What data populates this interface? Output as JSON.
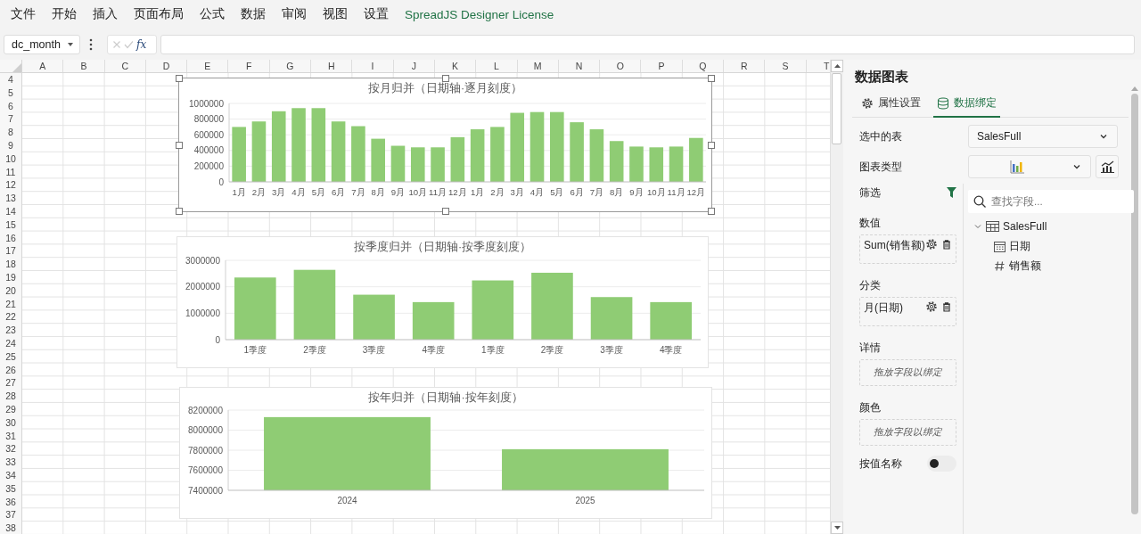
{
  "menu": [
    {
      "label": "文件",
      "kind": "menu"
    },
    {
      "label": "开始",
      "kind": "menu"
    },
    {
      "label": "插入",
      "kind": "menu"
    },
    {
      "label": "页面布局",
      "kind": "menu"
    },
    {
      "label": "公式",
      "kind": "menu"
    },
    {
      "label": "数据",
      "kind": "menu"
    },
    {
      "label": "审阅",
      "kind": "menu"
    },
    {
      "label": "视图",
      "kind": "menu"
    },
    {
      "label": "设置",
      "kind": "menu"
    },
    {
      "label": "SpreadJS Designer License",
      "kind": "link"
    }
  ],
  "formula_bar": {
    "name_box": "dc_month",
    "function_label": "fx"
  },
  "sheet": {
    "columns": [
      "A",
      "B",
      "C",
      "D",
      "E",
      "F",
      "G",
      "H",
      "I",
      "J",
      "K",
      "L",
      "M",
      "N",
      "O",
      "P",
      "Q",
      "R",
      "S",
      "T"
    ],
    "rows": [
      "4",
      "5",
      "6",
      "7",
      "8",
      "9",
      "10",
      "11",
      "12",
      "13",
      "14",
      "15",
      "16",
      "17",
      "18",
      "19",
      "20",
      "21",
      "22",
      "23",
      "24",
      "25",
      "26",
      "27",
      "28",
      "29",
      "30",
      "31",
      "32",
      "33",
      "34",
      "35",
      "36",
      "37",
      "38"
    ]
  },
  "charts": [
    {
      "selected": true,
      "chart_data": {
        "type": "bar",
        "title": "按月归并（日期轴·逐月刻度）",
        "categories": [
          "1月",
          "2月",
          "3月",
          "4月",
          "5月",
          "6月",
          "7月",
          "8月",
          "9月",
          "10月",
          "11月",
          "12月",
          "1月",
          "2月",
          "3月",
          "4月",
          "5月",
          "6月",
          "7月",
          "8月",
          "9月",
          "10月",
          "11月",
          "12月"
        ],
        "series": [
          {
            "color": "#8fcc74",
            "values": [
              700000,
              770000,
              900000,
              940000,
              940000,
              770000,
              710000,
              550000,
              460000,
              440000,
              440000,
              570000,
              670000,
              700000,
              880000,
              890000,
              890000,
              760000,
              670000,
              520000,
              450000,
              440000,
              450000,
              560000
            ]
          }
        ],
        "ylim": [
          0,
          1000000
        ],
        "yticks": [
          0,
          200000,
          400000,
          600000,
          800000,
          1000000
        ],
        "grid": true
      }
    },
    {
      "selected": false,
      "chart_data": {
        "type": "bar",
        "title": "按季度归并（日期轴·按季度刻度）",
        "categories": [
          "1季度",
          "2季度",
          "3季度",
          "4季度",
          "1季度",
          "2季度",
          "3季度",
          "4季度"
        ],
        "series": [
          {
            "color": "#8fcc74",
            "values": [
              2350000,
              2640000,
              1700000,
              1420000,
              2240000,
              2530000,
              1610000,
              1420000
            ]
          }
        ],
        "ylim": [
          0,
          3000000
        ],
        "yticks": [
          0,
          1000000,
          2000000,
          3000000
        ],
        "grid": true
      }
    },
    {
      "selected": false,
      "chart_data": {
        "type": "bar",
        "title": "按年归并（日期轴·按年刻度）",
        "categories": [
          "2024",
          "2025"
        ],
        "series": [
          {
            "color": "#8fcc74",
            "values": [
              8130000,
              7810000
            ]
          }
        ],
        "ylim": [
          7400000,
          8200000
        ],
        "yticks": [
          7400000,
          7600000,
          7800000,
          8000000,
          8200000
        ],
        "grid": true
      }
    }
  ],
  "panel": {
    "title": "数据图表",
    "tabs": [
      {
        "label": "属性设置",
        "selected": false
      },
      {
        "label": "数据绑定",
        "selected": true
      }
    ],
    "table_select": {
      "label": "选中的表",
      "value": "SalesFull"
    },
    "chart_type": {
      "label": "图表类型"
    },
    "bindings": [
      {
        "kind": "filter",
        "label": "筛选"
      },
      {
        "kind": "field",
        "label": "数值",
        "value": "Sum(销售额)"
      },
      {
        "kind": "field",
        "label": "分类",
        "value": "月(日期)"
      },
      {
        "kind": "drop",
        "label": "详情",
        "placeholder": "拖放字段以绑定"
      },
      {
        "kind": "drop",
        "label": "颜色",
        "placeholder": "拖放字段以绑定"
      },
      {
        "kind": "toggle",
        "label": "按值名称",
        "on": false
      }
    ],
    "field_search": {
      "placeholder": "查找字段..."
    },
    "field_tree": [
      {
        "label": "SalesFull",
        "expanded": true,
        "children": [
          {
            "label": "日期",
            "kind": "date"
          },
          {
            "label": "销售额",
            "kind": "number"
          }
        ]
      }
    ]
  }
}
